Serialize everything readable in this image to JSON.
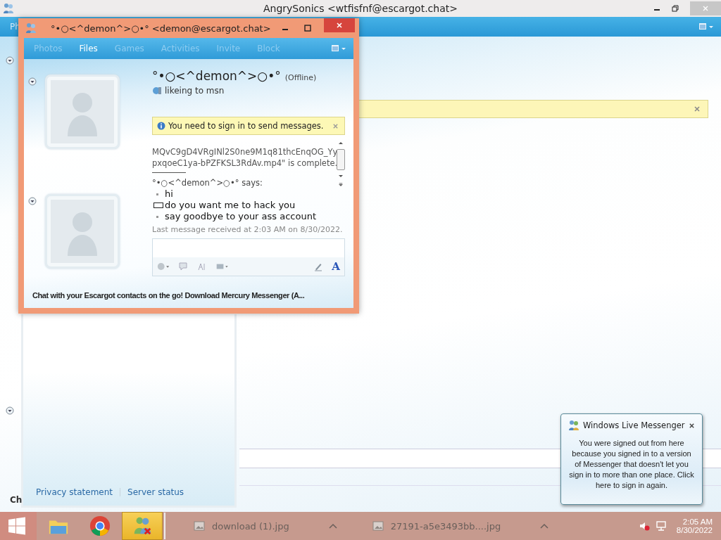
{
  "main_window": {
    "title": "AngrySonics <wtfisfnf@escargot.chat>",
    "toolbar_tab_partial": "Ph",
    "footer_links": [
      "Privacy statement",
      "Server status"
    ],
    "footer_text_partial": "Ch"
  },
  "chat_window": {
    "title": "°•○<^demon^>○•° <demon@escargot.chat>",
    "tabs": [
      {
        "label": "Photos",
        "selected": false
      },
      {
        "label": "Files",
        "selected": true
      },
      {
        "label": "Games",
        "selected": false
      },
      {
        "label": "Activities",
        "selected": false
      },
      {
        "label": "Invite",
        "selected": false
      },
      {
        "label": "Block",
        "selected": false
      }
    ],
    "contact": {
      "name": "°•○<^demon^>○•°",
      "status": "(Offline)",
      "personal_message": "likeing to msn"
    },
    "infobar": "You need to sign in to send messages.",
    "transcript": {
      "file_lines": [
        "MQvC9gD4VRgINl2S0ne9M1q81thcEnqOG_Yy",
        "pxqoeC1ya-bPZFKSL3RdAv.mp4\" is complete."
      ],
      "sender": "°•○<^demon^>○•° says:",
      "messages": [
        {
          "kind": "bullet",
          "text": "hi"
        },
        {
          "kind": "box",
          "text": "do you want me to hack you"
        },
        {
          "kind": "bullet",
          "text": "say goodbye to your ass account"
        }
      ],
      "last_received": "Last message received at 2:03 AM on 8/30/2022."
    },
    "font_button": "A",
    "ad": "Chat with your Escargot contacts on the go! Download Mercury Messenger (A..."
  },
  "notification": {
    "title": "Windows Live Messenger",
    "body": "You were signed out from here because you signed in to a version of Messenger that doesn't let you sign in to more than one place. Click here to sign in again."
  },
  "taskbar": {
    "apps": [
      {
        "kind": "explorer",
        "selected": false
      },
      {
        "kind": "browser",
        "selected": false
      },
      {
        "kind": "messenger",
        "selected": true
      }
    ],
    "downloads": [
      {
        "name": "download (1).jpg"
      },
      {
        "name": "27191-a5e3493bb....jpg"
      }
    ],
    "clock": {
      "time": "2:05 AM",
      "date": "8/30/2022"
    }
  }
}
